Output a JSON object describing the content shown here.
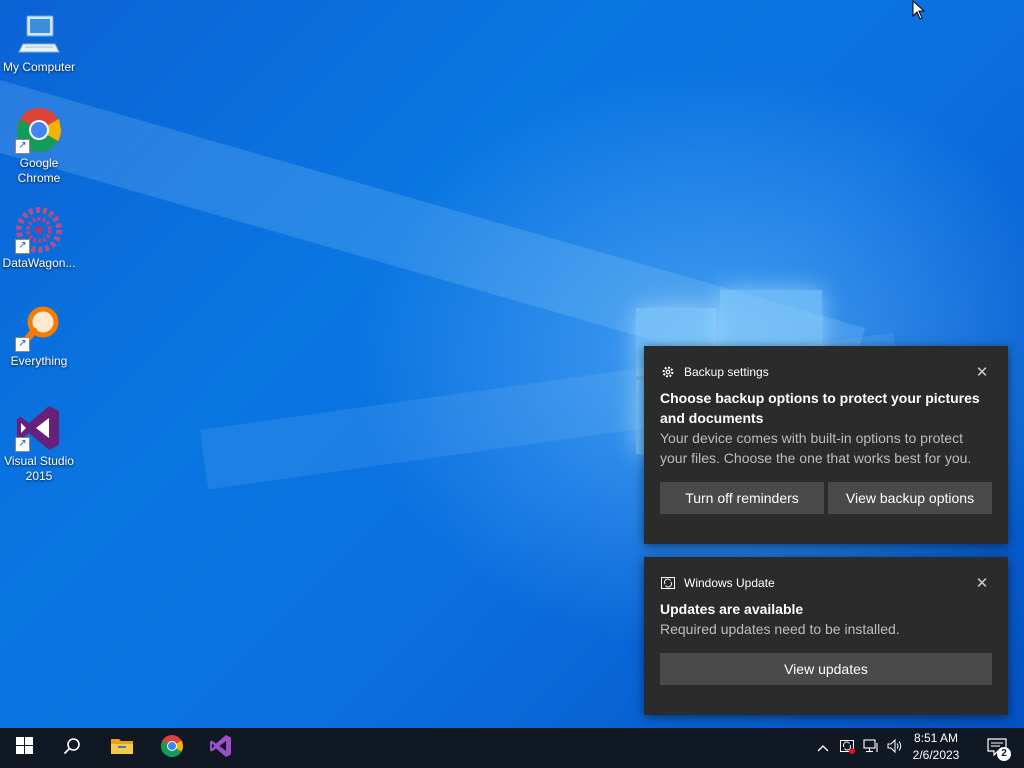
{
  "desktop": {
    "icons": [
      {
        "label": "My Computer",
        "icon": "computer-icon"
      },
      {
        "label": "Google Chrome",
        "icon": "chrome-icon"
      },
      {
        "label": "DataWagon...",
        "icon": "datawagon-icon"
      },
      {
        "label": "Everything",
        "icon": "everything-icon"
      },
      {
        "label": "Visual Studio 2015",
        "icon": "visual-studio-icon"
      }
    ]
  },
  "notifications": [
    {
      "app": "Backup settings",
      "app_icon": "gear-icon",
      "title": "Choose backup options to protect your pictures and documents",
      "body": "Your device comes with built-in options to protect your files. Choose the one that works best for you.",
      "actions": [
        "Turn off reminders",
        "View backup options"
      ]
    },
    {
      "app": "Windows Update",
      "app_icon": "windows-update-icon",
      "title": "Updates are available",
      "body": "Required updates need to be installed.",
      "actions": [
        "View updates"
      ]
    }
  ],
  "taskbar": {
    "pinned": [
      "start-icon",
      "search-icon",
      "file-explorer-icon",
      "chrome-icon",
      "visual-studio-icon"
    ],
    "clock": {
      "time": "8:51 AM",
      "date": "2/6/2023"
    },
    "notification_count": "2"
  },
  "colors": {
    "toast_bg": "#2b2b2b",
    "button_bg": "#4a4a4a",
    "taskbar_bg": "#101824",
    "desktop_blue": "#0a6fe0"
  }
}
